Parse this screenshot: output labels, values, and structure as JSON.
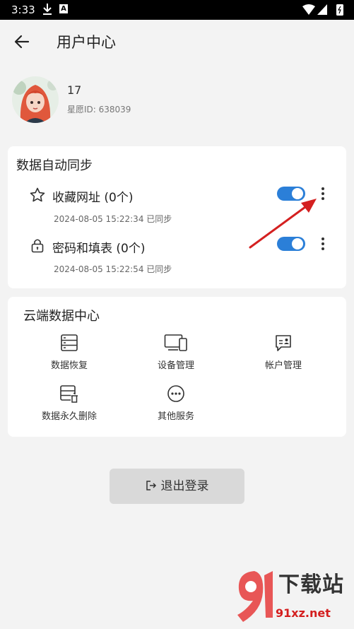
{
  "status_bar": {
    "time": "3:33"
  },
  "header": {
    "title": "用户中心"
  },
  "profile": {
    "name": "17",
    "star_id": "星愿ID:  638039"
  },
  "sync_card": {
    "title": "数据自动同步",
    "items": [
      {
        "label": "收藏网址 (0个)",
        "sub": "2024-08-05 15:22:34 已同步",
        "icon": "star-icon",
        "enabled": true
      },
      {
        "label": "密码和填表 (0个)",
        "sub": "2024-08-05 15:22:54 已同步",
        "icon": "lock-icon",
        "enabled": true
      }
    ]
  },
  "cloud_card": {
    "title": "云端数据中心",
    "items": [
      {
        "label": "数据恢复",
        "icon": "data-restore-icon"
      },
      {
        "label": "设备管理",
        "icon": "devices-icon"
      },
      {
        "label": "帐户管理",
        "icon": "account-manage-icon"
      },
      {
        "label": "数据永久删除",
        "icon": "data-delete-icon"
      },
      {
        "label": "其他服务",
        "icon": "more-services-icon"
      }
    ]
  },
  "logout": {
    "label": "退出登录"
  },
  "watermark": {
    "title": "下载站",
    "url": "91xz.net"
  },
  "colors": {
    "accent": "#2b7fd8",
    "annotation_arrow": "#d42020"
  }
}
